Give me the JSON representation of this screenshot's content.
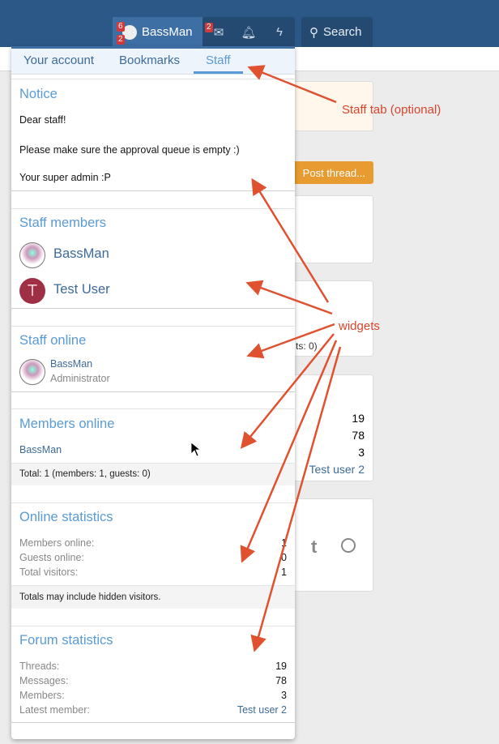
{
  "header": {
    "user": "BassMan",
    "user_badges": [
      "6",
      "2"
    ],
    "inbox_badge": "2",
    "search": "Search"
  },
  "background": {
    "post_thread": "Post thread...",
    "partial_guests": "ts: 0)",
    "stats": [
      "19",
      "78",
      "3"
    ],
    "latest_member": "Test user 2"
  },
  "dropdown": {
    "tabs": [
      {
        "label": "Your account"
      },
      {
        "label": "Bookmarks"
      },
      {
        "label": "Staff",
        "active": true
      }
    ],
    "notice": {
      "title": "Notice",
      "lines": [
        "Dear staff!",
        "Please make sure the approval queue is empty :)",
        "Your super admin :P"
      ]
    },
    "staff_members": {
      "title": "Staff members",
      "members": [
        {
          "name": "BassMan"
        },
        {
          "name": "Test User",
          "initial": "T"
        }
      ]
    },
    "staff_online": {
      "title": "Staff online",
      "name": "BassMan",
      "role": "Administrator"
    },
    "members_online": {
      "title": "Members online",
      "name": "BassMan",
      "footer": "Total: 1 (members: 1, guests: 0)"
    },
    "online_statistics": {
      "title": "Online statistics",
      "rows": [
        {
          "label": "Members online:",
          "value": "1"
        },
        {
          "label": "Guests online:",
          "value": "0"
        },
        {
          "label": "Total visitors:",
          "value": "1"
        }
      ],
      "footer": "Totals may include hidden visitors."
    },
    "forum_statistics": {
      "title": "Forum statistics",
      "rows": [
        {
          "label": "Threads:",
          "value": "19"
        },
        {
          "label": "Messages:",
          "value": "78"
        },
        {
          "label": "Members:",
          "value": "3"
        },
        {
          "label": "Latest member:",
          "value": "Test user 2"
        }
      ]
    }
  },
  "annotations": {
    "staff_tab": "Staff tab (optional)",
    "widgets": "widgets"
  },
  "colors": {
    "header": "#2b5886",
    "accent": "#5a9bd6",
    "annotation": "#d9452b",
    "button": "#e89b31"
  }
}
